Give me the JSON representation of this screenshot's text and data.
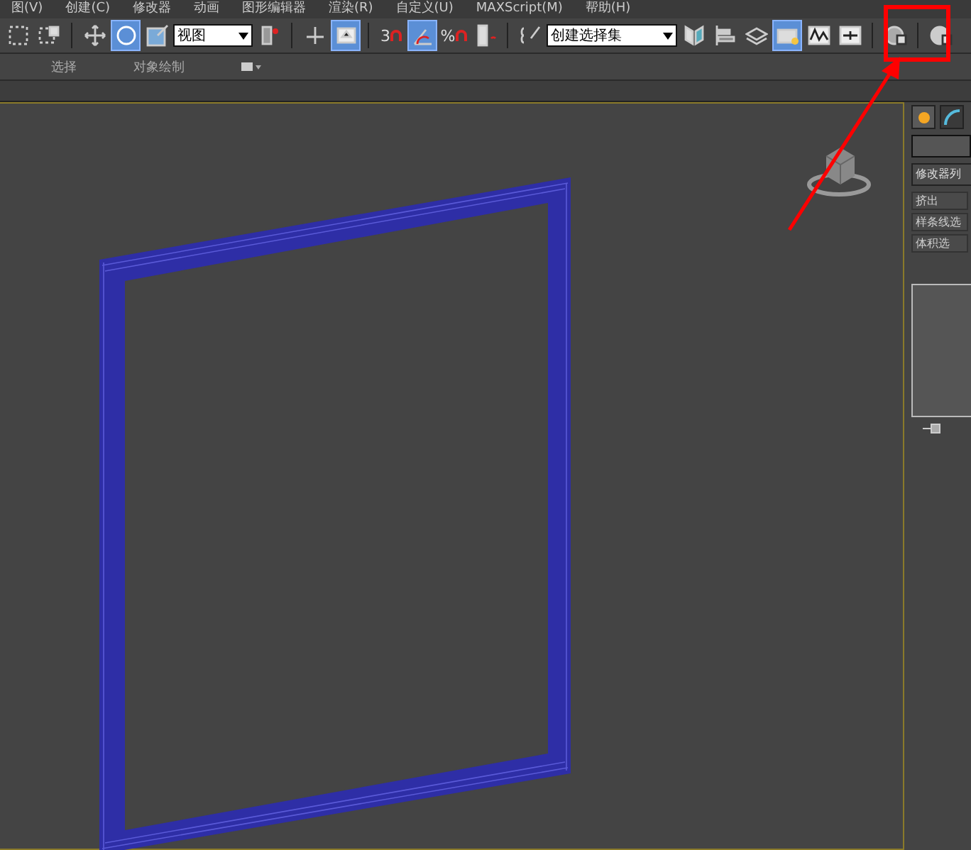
{
  "menu": [
    "图(V)",
    "创建(C)",
    "修改器",
    "动画",
    "图形编辑器",
    "渲染(R)",
    "自定义(U)",
    "MAXScript(M)",
    "帮助(H)"
  ],
  "toolbar": [
    {
      "kind": "rectselect",
      "selected": false
    },
    {
      "kind": "crossing",
      "selected": false
    },
    {
      "kind": "separator"
    },
    {
      "kind": "move",
      "selected": false
    },
    {
      "kind": "rotate",
      "selected": true
    },
    {
      "kind": "scale",
      "selected": false
    },
    {
      "kind": "dropdown",
      "value": "视图"
    },
    {
      "kind": "placement",
      "selected": false
    },
    {
      "kind": "separator"
    },
    {
      "kind": "pivot",
      "selected": false
    },
    {
      "kind": "manipulate",
      "selected": true
    },
    {
      "kind": "separator"
    },
    {
      "kind": "snap",
      "text": "3",
      "selected": false
    },
    {
      "kind": "anglesnap",
      "selected": true
    },
    {
      "kind": "snap",
      "text": "%",
      "selected": false
    },
    {
      "kind": "spinner",
      "selected": false
    },
    {
      "kind": "separator"
    },
    {
      "kind": "namedsel",
      "selected": false
    },
    {
      "kind": "dropdown",
      "value": "创建选择集"
    },
    {
      "kind": "mirror",
      "selected": false
    },
    {
      "kind": "align",
      "selected": false
    },
    {
      "kind": "layers",
      "selected": false
    },
    {
      "kind": "explorer",
      "selected": true
    },
    {
      "kind": "curve",
      "selected": false
    },
    {
      "kind": "schematic",
      "selected": false
    },
    {
      "kind": "separator"
    },
    {
      "kind": "material",
      "selected": false
    },
    {
      "kind": "separator"
    },
    {
      "kind": "render",
      "selected": false
    }
  ],
  "ribbon": {
    "tabs": [
      "选择",
      "对象绘制"
    ]
  },
  "command_panel": {
    "tabs": [
      {
        "kind": "create",
        "selected": true
      },
      {
        "kind": "modify",
        "selected": false
      }
    ],
    "modifier_list": "修改器列",
    "buttons": [
      "挤出",
      "样条线选",
      "体积选"
    ]
  }
}
